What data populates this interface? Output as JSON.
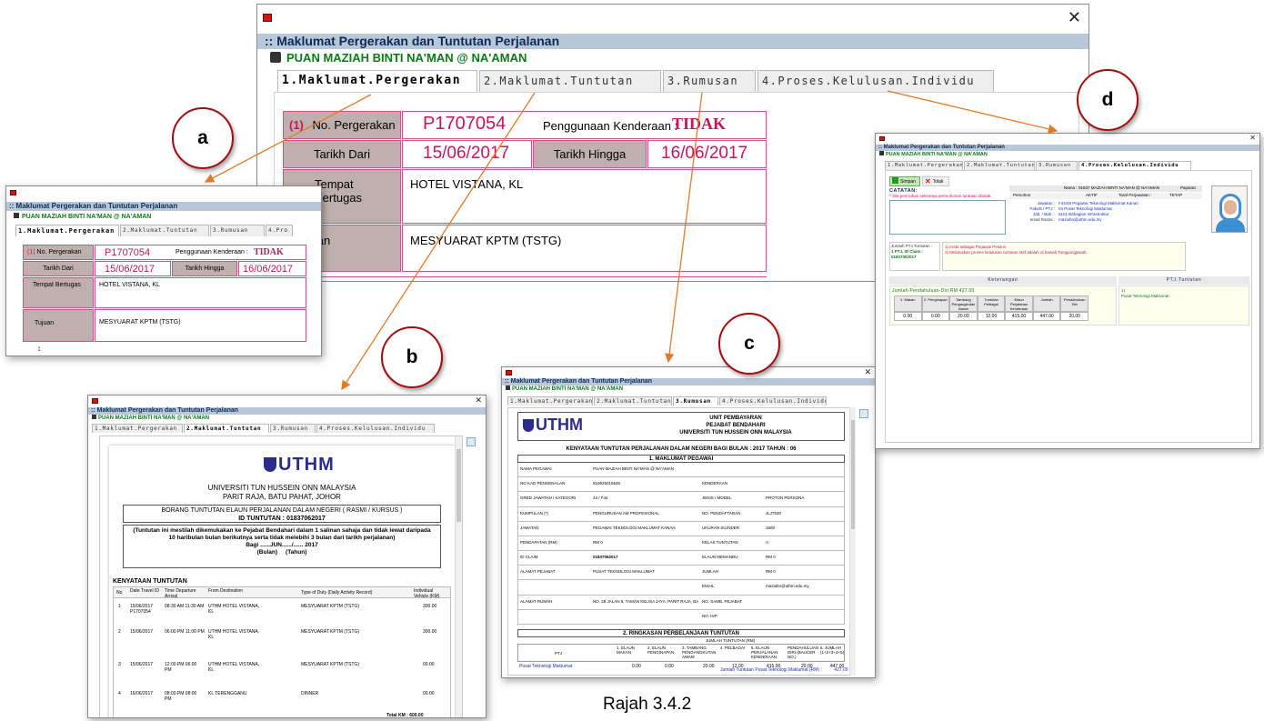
{
  "window": {
    "title_bar": ":: Maklumat Pergerakan dan Tuntutan Perjalanan",
    "name": "PUAN MAZIAH BINTI NA'MAN @ NA'AMAN",
    "tabs": [
      "1.Maklumat.Pergerakan",
      "2.Maklumat.Tuntutan",
      "3.Rumusan",
      "4.Proses.Kelulusan.Individu"
    ]
  },
  "main": {
    "num": "(1)",
    "no_label": "No. Pergerakan",
    "no_value": "P1707054",
    "kend_label": "Penggunaan Kenderaan :",
    "kend_value": "TIDAK",
    "dari_label": "Tarikh Dari",
    "dari_value": "15/06/2017",
    "hingga_label": "Tarikh Hingga",
    "hingga_value": "16/06/2017",
    "tempat_label": "Tempat Bertugas",
    "tempat_value": "HOTEL VISTANA, KL",
    "tujuan_label": "Tujuan",
    "tujuan_value": "MESYUARAT KPTM (TSTG)"
  },
  "callouts": {
    "a": "a",
    "b": "b",
    "c": "c",
    "d": "d"
  },
  "panel_a": {
    "tab4": "4.Pro",
    "num": "1"
  },
  "panel_b": {
    "logo": "UTHM",
    "univ": "UNIVERSITI TUN HUSSEIN ONN MALAYSIA",
    "addr": "PARIT RAJA, BATU PAHAT, JOHOR",
    "form_title": "BORANG TUNTUTAN ELAUN PERJALANAN DALAM NEGERI ( RASMI / KURSUS )",
    "id_tuntutan": "ID TUNTUTAN : 01837062017",
    "note": "(Tuntutan ini mestilah dikemukakan ke Pejabat Bendahari dalam 1 salinan sahaja dan tidak lewat daripada 10 haribulan bulan berikutnya serta tidak melebihi 3 bulan dari tarikh perjalanan)",
    "bagi": "Bagi",
    "bulan": "JUN",
    "tahun": "2017",
    "bulan_lbl": "(Bulan)",
    "tahun_lbl": "(Tahun)",
    "kenyataan": "KENYATAAN TUNTUTAN",
    "headers": [
      "No",
      "Date Travel ID",
      "Time Departure Arrival",
      "From Destination",
      "Type of Duty (Daily Activity Record)",
      "Individual Vehicle (KM)"
    ],
    "rows": [
      [
        "1",
        "15/06/2017 P1707054",
        "08:30 AM 11:30 AM",
        "UTHM HOTEL VISTANA, KL",
        "MESYUARAT KPTM (TSTG)",
        "300.00"
      ],
      [
        "2",
        "15/06/2017",
        "06:00 PM 11:00 PM",
        "UTHM HOTEL VISTANA, KL",
        "MESYUARAT KPTM (TSTG)",
        "300.00"
      ],
      [
        "3",
        "15/06/2017",
        "12:00 PM 06:00 PM",
        "UTHM HOTEL VISTANA, KL",
        "MESYUARAT KPTM (TSTG)",
        "00.00"
      ],
      [
        "4",
        "16/06/2017",
        "08:00 PM 08:00 PM",
        "KL TERENGGANU",
        "DINNER",
        "00.00"
      ]
    ],
    "total_label": "Total KM :",
    "total": "600.00"
  },
  "panel_c": {
    "logo": "UTHM",
    "unit": "UNIT PEMBAYARAN",
    "pejabat": "PEJABAT BENDAHARI",
    "univ": "UNIVERSITI TUN HUSSEIN ONN MALAYSIA",
    "heading": "KENYATAAN TUNTUTAN PERJALANAN DALAM NEGERI BAGI BULAN : 2017 TAHUN : 06",
    "sec1": "1. MAKLUMAT PEGAWAI",
    "fields": [
      [
        "NAMA PEGAWAI",
        "PUAN MAZIAH BINTI NA'MAN @ NA'AMAN",
        "",
        ""
      ],
      [
        "NO KAD PENGENALAN",
        "810625015646",
        "KENDERAAN",
        ""
      ],
      [
        "GRED JAWATAN / KATEGORI",
        "44 / F44",
        "JENIS / MODEL",
        "PROTON PERSONA"
      ],
      [
        "KUMPULAN (*)",
        "PENGURUSAN AM PROFESIONAL",
        "NO. PENDAFTARAN",
        "JLJ7530"
      ],
      [
        "JAWATAN",
        "PEGAWAI TEKNOLOGI MAKLUMAT KANAN",
        "UKURAN SILINDER",
        "1600"
      ],
      [
        "PENDAPATAN (RM)",
        "RM 0",
        "KELAS TUNTUTAN",
        "A"
      ],
      [
        "ID CLAIM",
        "01837062017",
        "ELAUN MEMANDU",
        "RM 0"
      ],
      [
        "ALAMAT PEJABAT",
        "PUSAT TEKNOLOGI MAKLUMAT",
        "JUMLAH",
        "RM 0"
      ],
      [
        "",
        "",
        "EMAIL",
        "maziahn@uthm.edu.my"
      ],
      [
        "ALAMAT RUMAH",
        "NO. 28 JALAN 5, TAMAN KELISA JAYA, PARIT RAJA, BATU PAHAT, 86400, Johor",
        "NO. SAMB. PEJABAT",
        ""
      ],
      [
        "",
        "",
        "NO. H/P",
        ""
      ]
    ],
    "sec2": "2. RINGKASAN PERBELANJAAN TUNTUTAN",
    "jumlah_hdr": "JUMLAH TUNTUTAN (RM)",
    "cols": [
      "PTJ",
      "1. ELAUN MAKAN",
      "2. ELAUN PENGINAPAN",
      "3. TAMBANG PENGANGKUTAN AWAM",
      "4. PELBAGAI",
      "5. ELAUN PERJALANAN KENDERAAN",
      "PENDAHULUAN DIRI (BAUCER NO.)",
      "6. JUMLAH (1+2+3+4+5)"
    ],
    "row": [
      "Pusat Teknologi Maklumat",
      "0.00",
      "0.00",
      "20.00",
      "12.00",
      "415.00",
      "20.00",
      "447.00"
    ],
    "footer": "Jumlah Tuntutan Pusat Teknologi Maklumat (RM) :",
    "footer_val": "427.00"
  },
  "panel_d": {
    "simpan": "Simpan",
    "tolak": "Tolak",
    "catatan": "CATATAN:",
    "catatan_note": "* Sila perincikan sekiranya permohonan tuntutan ditolak.",
    "nama_lbl": "Nama :",
    "nama": "01837  MAZIAH BINTI NA'MAN @ NA'AMAN",
    "paparan": "Paparan",
    "pemohon": "Pemohon",
    "lajur1": [
      "Jawatan :",
      "Fakulti / PTJ :",
      "Jab. / Bah. :",
      "email Rasmi :"
    ],
    "lajur1_val": [
      "F44/48  Pegawai Teknologi Maklumat Kanan",
      "04  Pusat Teknologi Maklumat",
      "6101  Bahagian Infrastruktur",
      "maziahn@uthm.edu.my"
    ],
    "aktif": "AKTIF",
    "taraf": "Taraf Perjawatan :",
    "tetap": "TETAP",
    "jumlah_ptj": "Jumlah PTJ Tuntutan :",
    "ptj_id": "1 PTJ, ID Claim :",
    "ptj_claim": "01837062017",
    "note1": "1) Anda sebagai Pegawai Pelulus.",
    "note2": "2) Meluluskan proses kelulusan tuntutan staf adalah di bawah Tanggungjawab.",
    "keterangan": "Keterangan",
    "ptj_tuntutan": "PTJ.Tuntutan",
    "jumlah_pend": "Jumlah-Pendahuluan-Diri:RM 427.00",
    "cols": [
      "1. Makan",
      "2. Penginapan",
      "Tambang Pengangkutan Awam",
      "Tuntutan Pelbagai",
      "Elaun Perjalanan Kenderaan",
      "Jumlah",
      "Pendahuluan Diri"
    ],
    "vals": [
      "0.00",
      "0.00",
      "20.00",
      "12.00",
      "415.00",
      "447.00",
      "20.00"
    ],
    "ptj1": "1)",
    "ptj_name": "Pusat Teknologi Maklumat"
  },
  "caption": "Rajah 3.4.2",
  "colors": {
    "accent": "#c2185b",
    "title": "#0c2a55",
    "green": "#0b7a17",
    "callout": "#a30c0c"
  }
}
